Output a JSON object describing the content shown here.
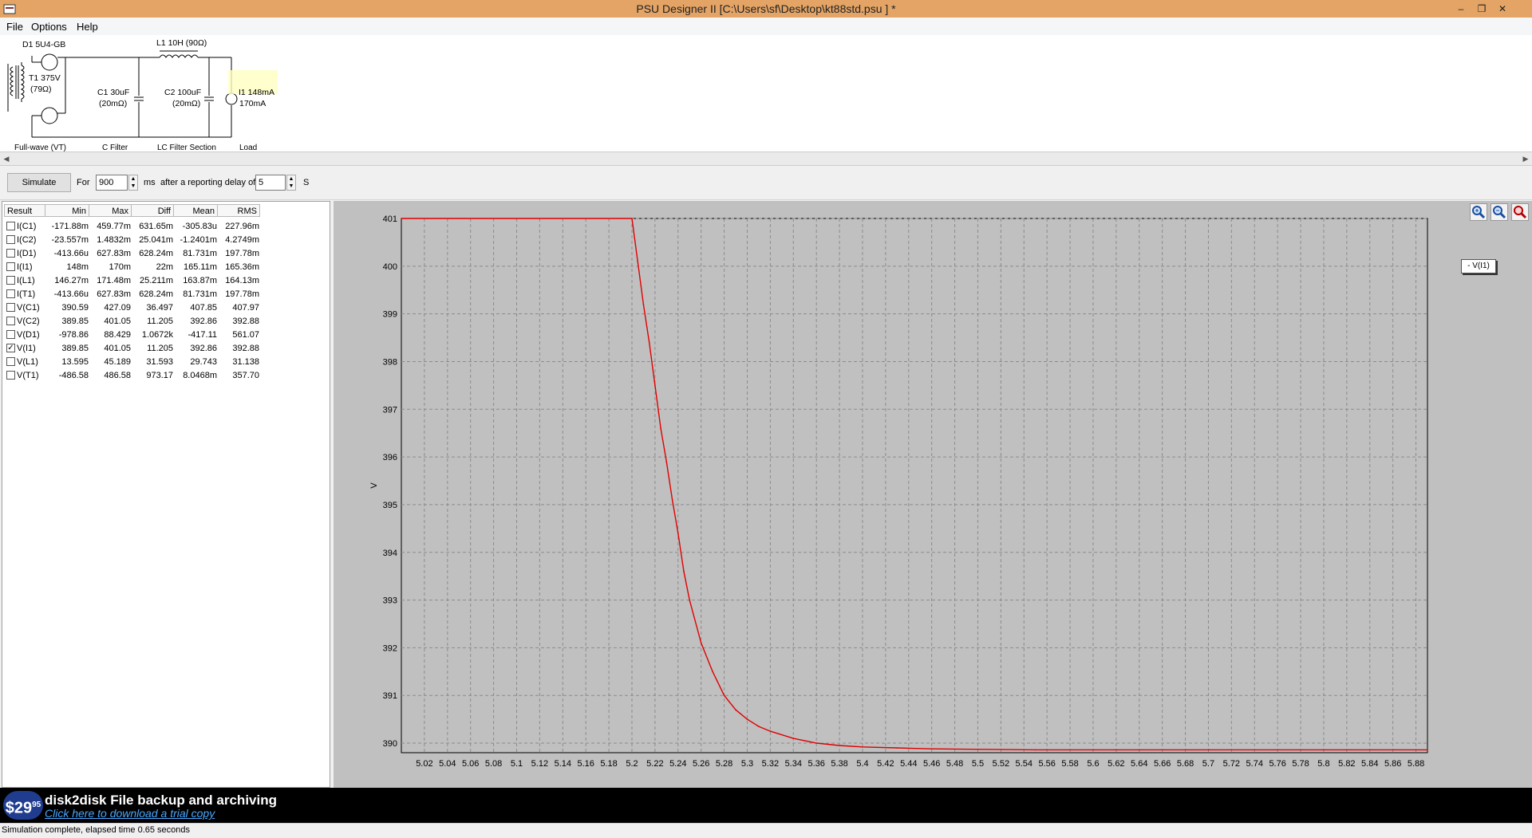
{
  "window": {
    "title": "PSU Designer II  [C:\\Users\\sf\\Desktop\\kt88std.psu ] *",
    "minimize": "–",
    "restore": "❐",
    "close": "✕"
  },
  "menu": {
    "file": "File",
    "options": "Options",
    "help": "Help"
  },
  "schematic": {
    "diode": "D1 5U4-GB",
    "transformer_line1": "T1 375V",
    "transformer_line2": "(79Ω)",
    "inductor": "L1 10H (90Ω)",
    "c1_line1": "C1 30uF",
    "c1_line2": "(20mΩ)",
    "c2_line1": "C2 100uF",
    "c2_line2": "(20mΩ)",
    "load_line1": "I1 148mA",
    "load_line2": "170mA",
    "caption_fullwave": "Full-wave (VT)",
    "caption_cfilter": "C Filter",
    "caption_lcfilter": "LC Filter Section",
    "caption_load": "Load"
  },
  "toolbar": {
    "simulate": "Simulate",
    "for_label": "For",
    "duration": "900",
    "ms_label": "ms",
    "delay_label": "after a reporting delay of",
    "delay": "5",
    "s_label": "S"
  },
  "results": {
    "headers": [
      "Result",
      "Min",
      "Max",
      "Diff",
      "Mean",
      "RMS"
    ],
    "rows": [
      {
        "name": "I(C1)",
        "min": "-171.88m",
        "max": "459.77m",
        "diff": "631.65m",
        "mean": "-305.83u",
        "rms": "227.96m",
        "checked": false
      },
      {
        "name": "I(C2)",
        "min": "-23.557m",
        "max": "1.4832m",
        "diff": "25.041m",
        "mean": "-1.2401m",
        "rms": "4.2749m",
        "checked": false
      },
      {
        "name": "I(D1)",
        "min": "-413.66u",
        "max": "627.83m",
        "diff": "628.24m",
        "mean": "81.731m",
        "rms": "197.78m",
        "checked": false
      },
      {
        "name": "I(I1)",
        "min": "148m",
        "max": "170m",
        "diff": "22m",
        "mean": "165.11m",
        "rms": "165.36m",
        "checked": false
      },
      {
        "name": "I(L1)",
        "min": "146.27m",
        "max": "171.48m",
        "diff": "25.211m",
        "mean": "163.87m",
        "rms": "164.13m",
        "checked": false
      },
      {
        "name": "I(T1)",
        "min": "-413.66u",
        "max": "627.83m",
        "diff": "628.24m",
        "mean": "81.731m",
        "rms": "197.78m",
        "checked": false
      },
      {
        "name": "V(C1)",
        "min": "390.59",
        "max": "427.09",
        "diff": "36.497",
        "mean": "407.85",
        "rms": "407.97",
        "checked": false
      },
      {
        "name": "V(C2)",
        "min": "389.85",
        "max": "401.05",
        "diff": "11.205",
        "mean": "392.86",
        "rms": "392.88",
        "checked": false
      },
      {
        "name": "V(D1)",
        "min": "-978.86",
        "max": "88.429",
        "diff": "1.0672k",
        "mean": "-417.11",
        "rms": "561.07",
        "checked": false
      },
      {
        "name": "V(I1)",
        "min": "389.85",
        "max": "401.05",
        "diff": "11.205",
        "mean": "392.86",
        "rms": "392.88",
        "checked": true
      },
      {
        "name": "V(L1)",
        "min": "13.595",
        "max": "45.189",
        "diff": "31.593",
        "mean": "29.743",
        "rms": "31.138",
        "checked": false
      },
      {
        "name": "V(T1)",
        "min": "-486.58",
        "max": "486.58",
        "diff": "973.17",
        "mean": "8.0468m",
        "rms": "357.70",
        "checked": false
      }
    ]
  },
  "zoom_icons": [
    "zoom-in-icon",
    "zoom-out-icon",
    "zoom-reset-icon"
  ],
  "chart_data": {
    "type": "line",
    "title": "",
    "xlabel": "",
    "ylabel": "V",
    "xlim": [
      5.0,
      5.89
    ],
    "ylim": [
      389.8,
      401.0
    ],
    "x_ticks": [
      "5.02",
      "5.04",
      "5.06",
      "5.08",
      "5.1",
      "5.12",
      "5.14",
      "5.16",
      "5.18",
      "5.2",
      "5.22",
      "5.24",
      "5.26",
      "5.28",
      "5.3",
      "5.32",
      "5.34",
      "5.36",
      "5.38",
      "5.4",
      "5.42",
      "5.44",
      "5.46",
      "5.48",
      "5.5",
      "5.52",
      "5.54",
      "5.56",
      "5.58",
      "5.6",
      "5.62",
      "5.64",
      "5.66",
      "5.68",
      "5.7",
      "5.72",
      "5.74",
      "5.76",
      "5.78",
      "5.8",
      "5.82",
      "5.84",
      "5.86",
      "5.88"
    ],
    "y_ticks": [
      "401",
      "400",
      "399",
      "398",
      "397",
      "396",
      "395",
      "394",
      "393",
      "392",
      "391",
      "390"
    ],
    "grid": true,
    "legend_position": "top-right",
    "series": [
      {
        "name": "V(I1)",
        "color": "#e00000",
        "x": [
          5.0,
          5.2,
          5.205,
          5.21,
          5.215,
          5.22,
          5.225,
          5.23,
          5.235,
          5.24,
          5.245,
          5.25,
          5.26,
          5.27,
          5.28,
          5.29,
          5.3,
          5.31,
          5.32,
          5.34,
          5.36,
          5.38,
          5.4,
          5.43,
          5.46,
          5.5,
          5.55,
          5.6,
          5.7,
          5.8,
          5.89
        ],
        "y": [
          401.0,
          401.0,
          400.1,
          399.2,
          398.4,
          397.5,
          396.6,
          395.9,
          395.1,
          394.4,
          393.6,
          393.0,
          392.1,
          391.5,
          391.0,
          390.7,
          390.5,
          390.35,
          390.25,
          390.1,
          390.0,
          389.95,
          389.92,
          389.9,
          389.88,
          389.87,
          389.86,
          389.86,
          389.86,
          389.86,
          389.86
        ]
      }
    ]
  },
  "legend": {
    "label": "- V(I1)"
  },
  "ad": {
    "price": "$29",
    "price_cents": "95",
    "headline": "disk2disk File backup and archiving",
    "link": "Click here to download a trial copy"
  },
  "status": {
    "text": "Simulation complete, elapsed time 0.65 seconds"
  }
}
